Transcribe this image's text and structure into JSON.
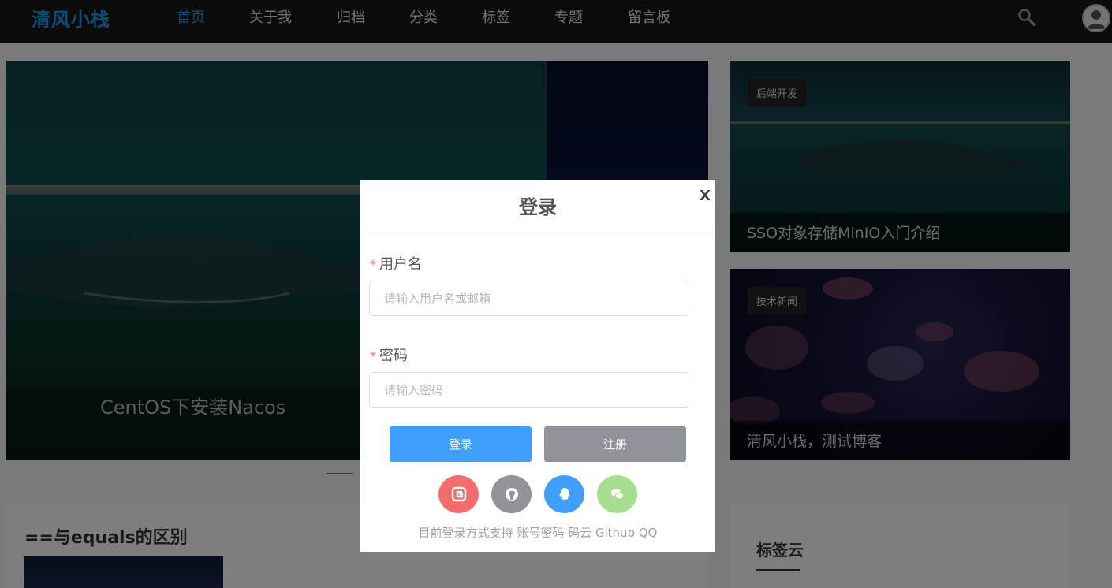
{
  "site": {
    "logo": "清风小栈"
  },
  "nav": {
    "items": [
      {
        "label": "首页"
      },
      {
        "label": "关于我"
      },
      {
        "label": "归档"
      },
      {
        "label": "分类"
      },
      {
        "label": "标签"
      },
      {
        "label": "专题"
      },
      {
        "label": "留言板"
      }
    ]
  },
  "hero": {
    "caption": "CentOS下安装Nacos"
  },
  "side_cards": [
    {
      "tag": "后端开发",
      "title": "SSO对象存储MinIO入门介绍"
    },
    {
      "tag": "技术新闻",
      "title": "清风小栈，测试博客"
    }
  ],
  "article": {
    "title": "==与equals的区别"
  },
  "tag_cloud": {
    "title": "标签云"
  },
  "login_modal": {
    "title": "登录",
    "close": "X",
    "username_label": "用户名",
    "username_placeholder": "请输入用户名或邮箱",
    "password_label": "密码",
    "password_placeholder": "请输入密码",
    "required_mark": "*",
    "login_button": "登录",
    "register_button": "注册",
    "hint": "目前登录方式支持 账号密码 码云 Github QQ",
    "social_icons": [
      "gitee-icon",
      "github-icon",
      "qq-icon",
      "wechat-icon"
    ]
  },
  "colors": {
    "accent": "#1a9be6",
    "primary_button": "#409eff",
    "secondary_button": "#909399",
    "gitee": "#f56c6c",
    "wechat": "#a5de8f",
    "required": "#f56c6c"
  }
}
